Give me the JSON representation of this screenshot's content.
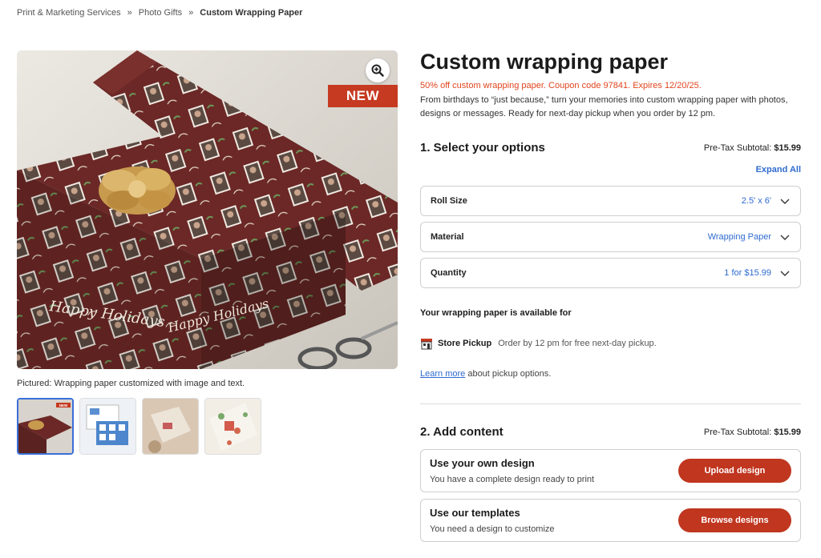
{
  "breadcrumb": {
    "items": [
      "Print & Marketing Services",
      "Photo Gifts"
    ],
    "current": "Custom Wrapping Paper",
    "separator": "»"
  },
  "gallery": {
    "badge": "NEW",
    "caption": "Pictured: Wrapping paper customized with image and text.",
    "thumb_badge": "NEW",
    "selected_thumb": 0,
    "thumb_count": 4,
    "image_text": "Happy Holidays"
  },
  "product": {
    "title": "Custom wrapping paper",
    "promo": "50% off custom wrapping paper. Coupon code 97841. Expires 12/20/25.",
    "description": "From birthdays to “just because,” turn your memories into custom wrapping paper with photos, designs or messages. Ready for next-day pickup when you order by 12 pm."
  },
  "options": {
    "heading": "1. Select your options",
    "subtotal_label": "Pre-Tax Subtotal:",
    "subtotal_value": "$15.99",
    "expand_all": "Expand All",
    "items": [
      {
        "label": "Roll Size",
        "value": "2.5' x 6'"
      },
      {
        "label": "Material",
        "value": "Wrapping Paper"
      },
      {
        "label": "Quantity",
        "value": "1 for $15.99"
      }
    ]
  },
  "availability": {
    "heading": "Your wrapping paper is available for",
    "method": "Store Pickup",
    "note": "Order by 12 pm for free next-day pickup.",
    "learn_link": "Learn more",
    "learn_rest": "about pickup options."
  },
  "content": {
    "heading": "2. Add content",
    "subtotal_label": "Pre-Tax Subtotal:",
    "subtotal_value": "$15.99",
    "cards": [
      {
        "title": "Use your own design",
        "desc": "You have a complete design ready to print",
        "button": "Upload design"
      },
      {
        "title": "Use our templates",
        "desc": "You need a design to customize",
        "button": "Browse designs"
      }
    ]
  },
  "colors": {
    "accent_red": "#c0361f",
    "promo": "#e0451f",
    "link_blue": "#2f6bd0",
    "paper_maroon": "#6e2a26"
  }
}
